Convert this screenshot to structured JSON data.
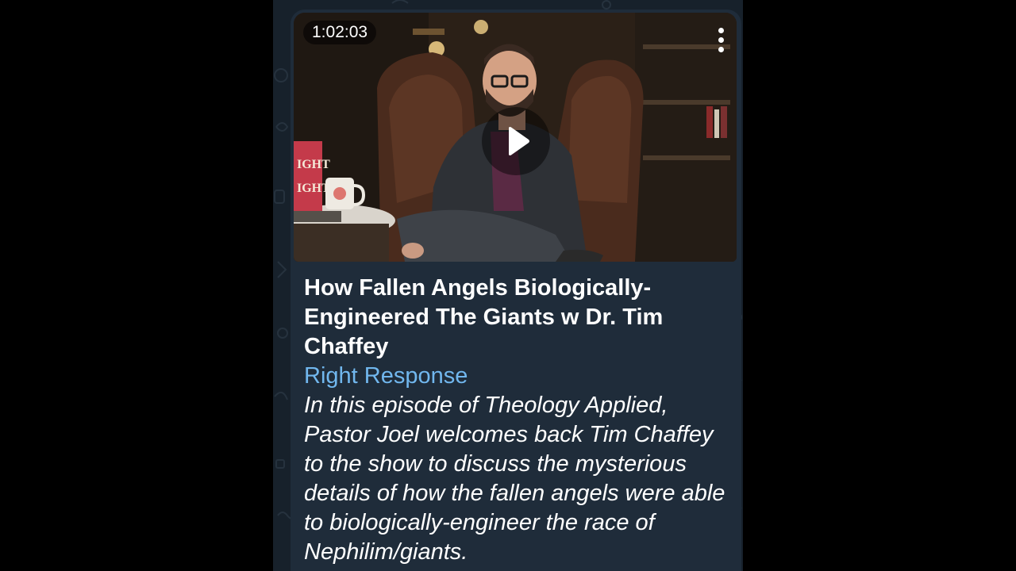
{
  "message": {
    "video": {
      "duration": "1:02:03",
      "play_icon": "play-icon",
      "menu_icon": "more-vertical-icon",
      "book_cover_text": [
        "IGHT",
        "IGHT"
      ]
    },
    "title": "How Fallen Angels Biologically-Engineered The Giants w Dr. Tim Chaffey",
    "channel": "Right Response",
    "description": "In this episode of Theology Applied, Pastor Joel welcomes back Tim Chaffey to the show to discuss the mysterious details of how the fallen angels were able to biologically-engineer the race of Nephilim/giants."
  },
  "colors": {
    "page_background": "#000000",
    "chat_background": "#17212b",
    "bubble_background": "#1f2c3a",
    "title_text": "#ffffff",
    "link_text": "#71b7ee",
    "description_text": "#ffffff"
  }
}
